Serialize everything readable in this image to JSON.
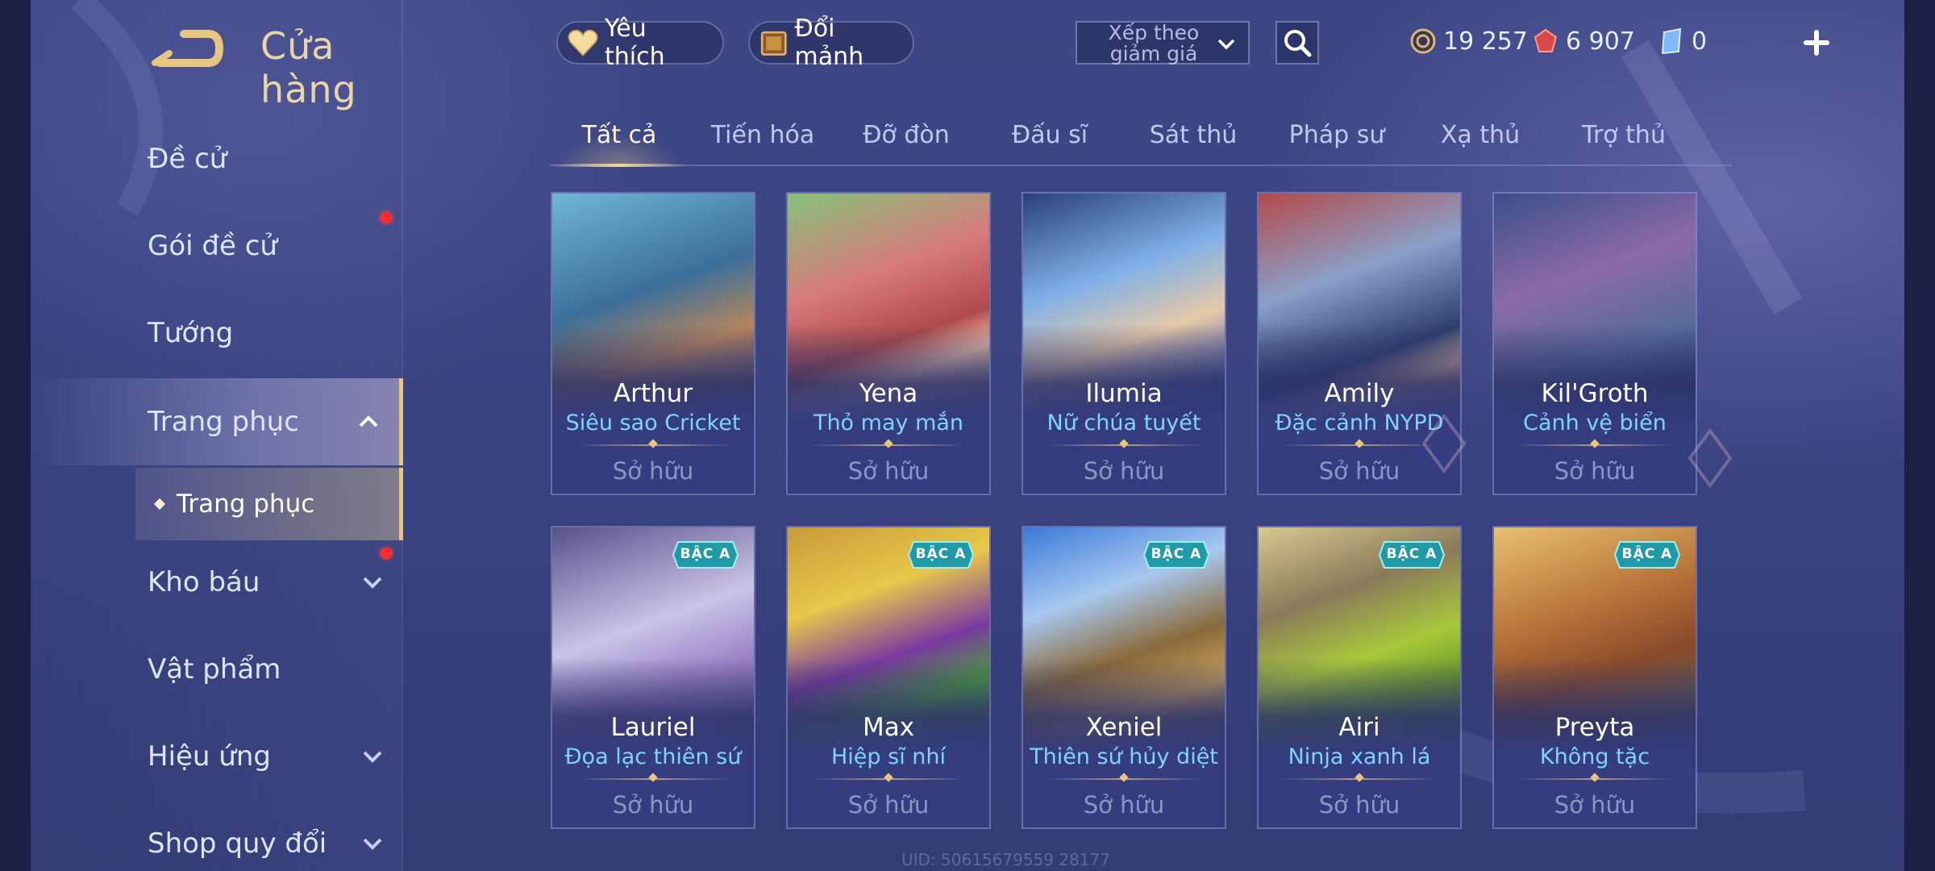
{
  "header": {
    "title": "Cửa hàng",
    "favorites_label": "Yêu thích",
    "exchange_label": "Đổi mảnh",
    "sort_label": "Xếp theo giảm giá"
  },
  "currencies": [
    {
      "name": "vàng",
      "value": "19 257",
      "color": "#d9b676"
    },
    {
      "name": "quân huy",
      "value": "6 907",
      "color": "#e05d5d"
    },
    {
      "name": "phiếu",
      "value": "0",
      "color": "#8ec8ff"
    }
  ],
  "sidebar": {
    "items": [
      {
        "label": "Đề cử"
      },
      {
        "label": "Gói đề cử"
      },
      {
        "label": "Tướng"
      },
      {
        "label": "Trang phục"
      },
      {
        "label": "Kho báu"
      },
      {
        "label": "Vật phẩm"
      },
      {
        "label": "Hiệu ứng"
      },
      {
        "label": "Shop quy đổi"
      }
    ],
    "sub_item": "Trang phục"
  },
  "tabs": [
    "Tất cả",
    "Tiến hóa",
    "Đỡ đòn",
    "Đấu sĩ",
    "Sát thủ",
    "Pháp sư",
    "Xạ thủ",
    "Trợ thủ"
  ],
  "cards": [
    {
      "hero": "Arthur",
      "skin": "Siêu sao Cricket",
      "status": "Sở hữu",
      "badge": ""
    },
    {
      "hero": "Yena",
      "skin": "Thỏ may mắn",
      "status": "Sở hữu",
      "badge": ""
    },
    {
      "hero": "Ilumia",
      "skin": "Nữ chúa tuyết",
      "status": "Sở hữu",
      "badge": ""
    },
    {
      "hero": "Amily",
      "skin": "Đặc cảnh NYPD",
      "status": "Sở hữu",
      "badge": ""
    },
    {
      "hero": "Kil'Groth",
      "skin": "Cảnh vệ biển",
      "status": "Sở hữu",
      "badge": ""
    },
    {
      "hero": "Lauriel",
      "skin": "Đọa lạc thiên sứ",
      "status": "Sở hữu",
      "badge": "BẬC A"
    },
    {
      "hero": "Max",
      "skin": "Hiệp sĩ nhí",
      "status": "Sở hữu",
      "badge": "BẬC A"
    },
    {
      "hero": "Xeniel",
      "skin": "Thiên sứ hủy diệt",
      "status": "Sở hữu",
      "badge": "BẬC A"
    },
    {
      "hero": "Airi",
      "skin": "Ninja xanh lá",
      "status": "Sở hữu",
      "badge": "BẬC A"
    },
    {
      "hero": "Preyta",
      "skin": "Không tặc",
      "status": "Sở hữu",
      "badge": "BẬC A"
    }
  ],
  "uid": "UID: 50615679559 28177",
  "colors": {
    "accent_gold": "#e7c77e",
    "skin_text": "#7fd4ff",
    "badge_teal": "#1f9aa6",
    "notify_red": "#ff2a2a"
  }
}
